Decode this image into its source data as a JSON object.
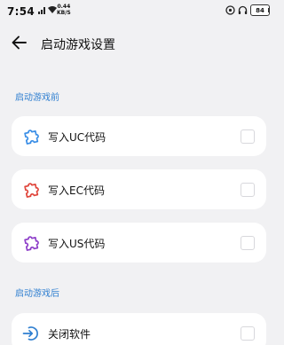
{
  "status_bar": {
    "time": "7:54",
    "speed_value": "0.44",
    "speed_unit": "KB/S",
    "battery": "84"
  },
  "header": {
    "title": "启动游戏设置"
  },
  "sections": [
    {
      "label": "启动游戏前",
      "items": [
        {
          "label": "写入UC代码",
          "icon": "puzzle-icon",
          "color": "#3a8ee6"
        },
        {
          "label": "写入EC代码",
          "icon": "puzzle-icon",
          "color": "#e0463c"
        },
        {
          "label": "写入US代码",
          "icon": "puzzle-icon",
          "color": "#8e3fc9"
        }
      ]
    },
    {
      "label": "启动游戏后",
      "items": [
        {
          "label": "关闭软件",
          "icon": "exit-icon",
          "color": "#2f7fd0"
        }
      ]
    }
  ]
}
